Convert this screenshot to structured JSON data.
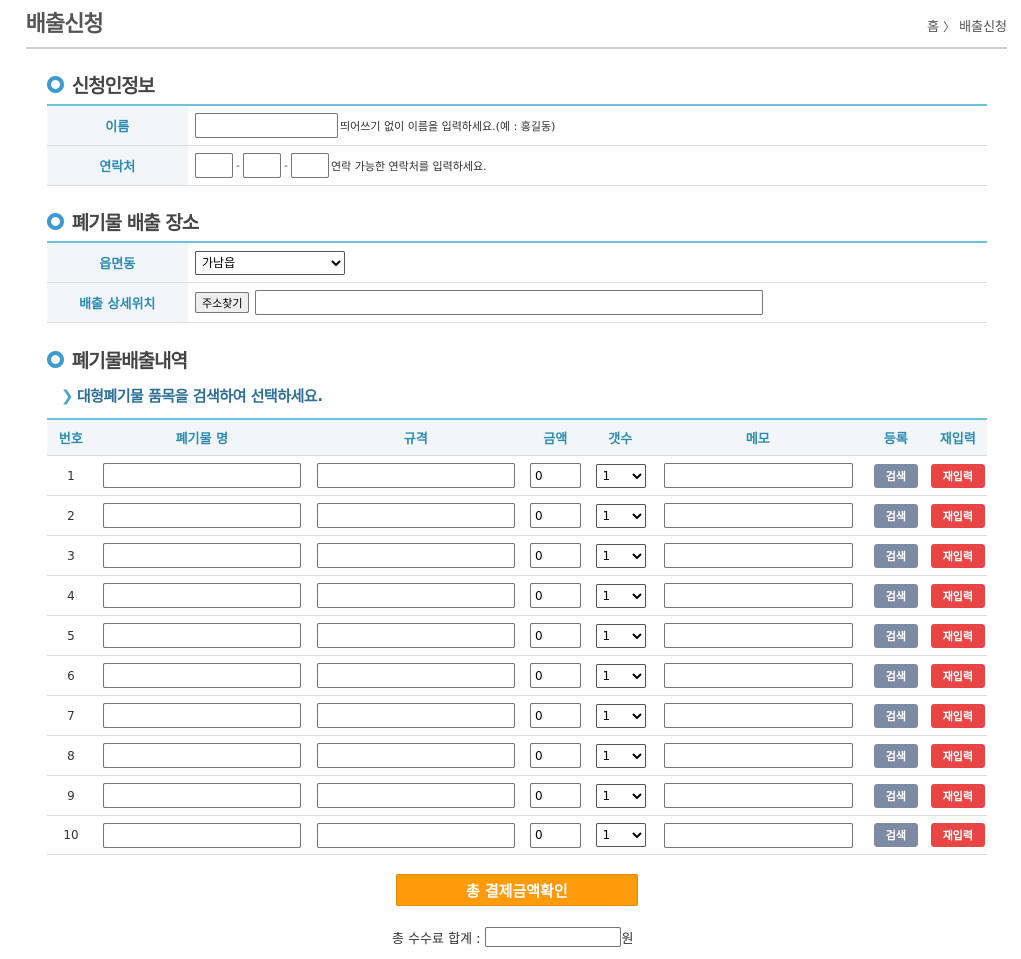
{
  "header": {
    "title": "배출신청",
    "breadcrumb_home": "홈",
    "breadcrumb_sep": "〉",
    "breadcrumb_current": "배출신청"
  },
  "applicant": {
    "section_title": "신청인정보",
    "name_label": "이름",
    "name_hint": "띄어쓰기 없이 이름을 입력하세요.(예 : 홍길동)",
    "phone_label": "연락처",
    "phone_dash": "-",
    "phone_hint": "연락 가능한 연락처를 입력하세요."
  },
  "location": {
    "section_title": "폐기물 배출 장소",
    "area_label": "읍면동",
    "area_selected": "가남읍",
    "detail_label": "배출 상세위치",
    "addr_button": "주소찾기"
  },
  "items": {
    "section_title": "폐기물배출내역",
    "guide": "대형폐기물 품목을 검색하여 선택하세요.",
    "columns": [
      "번호",
      "폐기물 명",
      "규격",
      "금액",
      "갯수",
      "메모",
      "등록",
      "재입력"
    ],
    "search_label": "검색",
    "reset_label": "재입력",
    "rows": [
      {
        "no": "1",
        "price": "0",
        "qty": "1"
      },
      {
        "no": "2",
        "price": "0",
        "qty": "1"
      },
      {
        "no": "3",
        "price": "0",
        "qty": "1"
      },
      {
        "no": "4",
        "price": "0",
        "qty": "1"
      },
      {
        "no": "5",
        "price": "0",
        "qty": "1"
      },
      {
        "no": "6",
        "price": "0",
        "qty": "1"
      },
      {
        "no": "7",
        "price": "0",
        "qty": "1"
      },
      {
        "no": "8",
        "price": "0",
        "qty": "1"
      },
      {
        "no": "9",
        "price": "0",
        "qty": "1"
      },
      {
        "no": "10",
        "price": "0",
        "qty": "1"
      }
    ]
  },
  "total": {
    "button": "총 결제금액확인",
    "label": "총 수수료 합계 :",
    "unit": "원"
  },
  "colors": {
    "accent": "#6cc2d9",
    "label_text": "#2c8bb2",
    "search_btn": "#7d8aa3",
    "reset_btn": "#e94545",
    "total_btn": "#ff9a0a"
  }
}
